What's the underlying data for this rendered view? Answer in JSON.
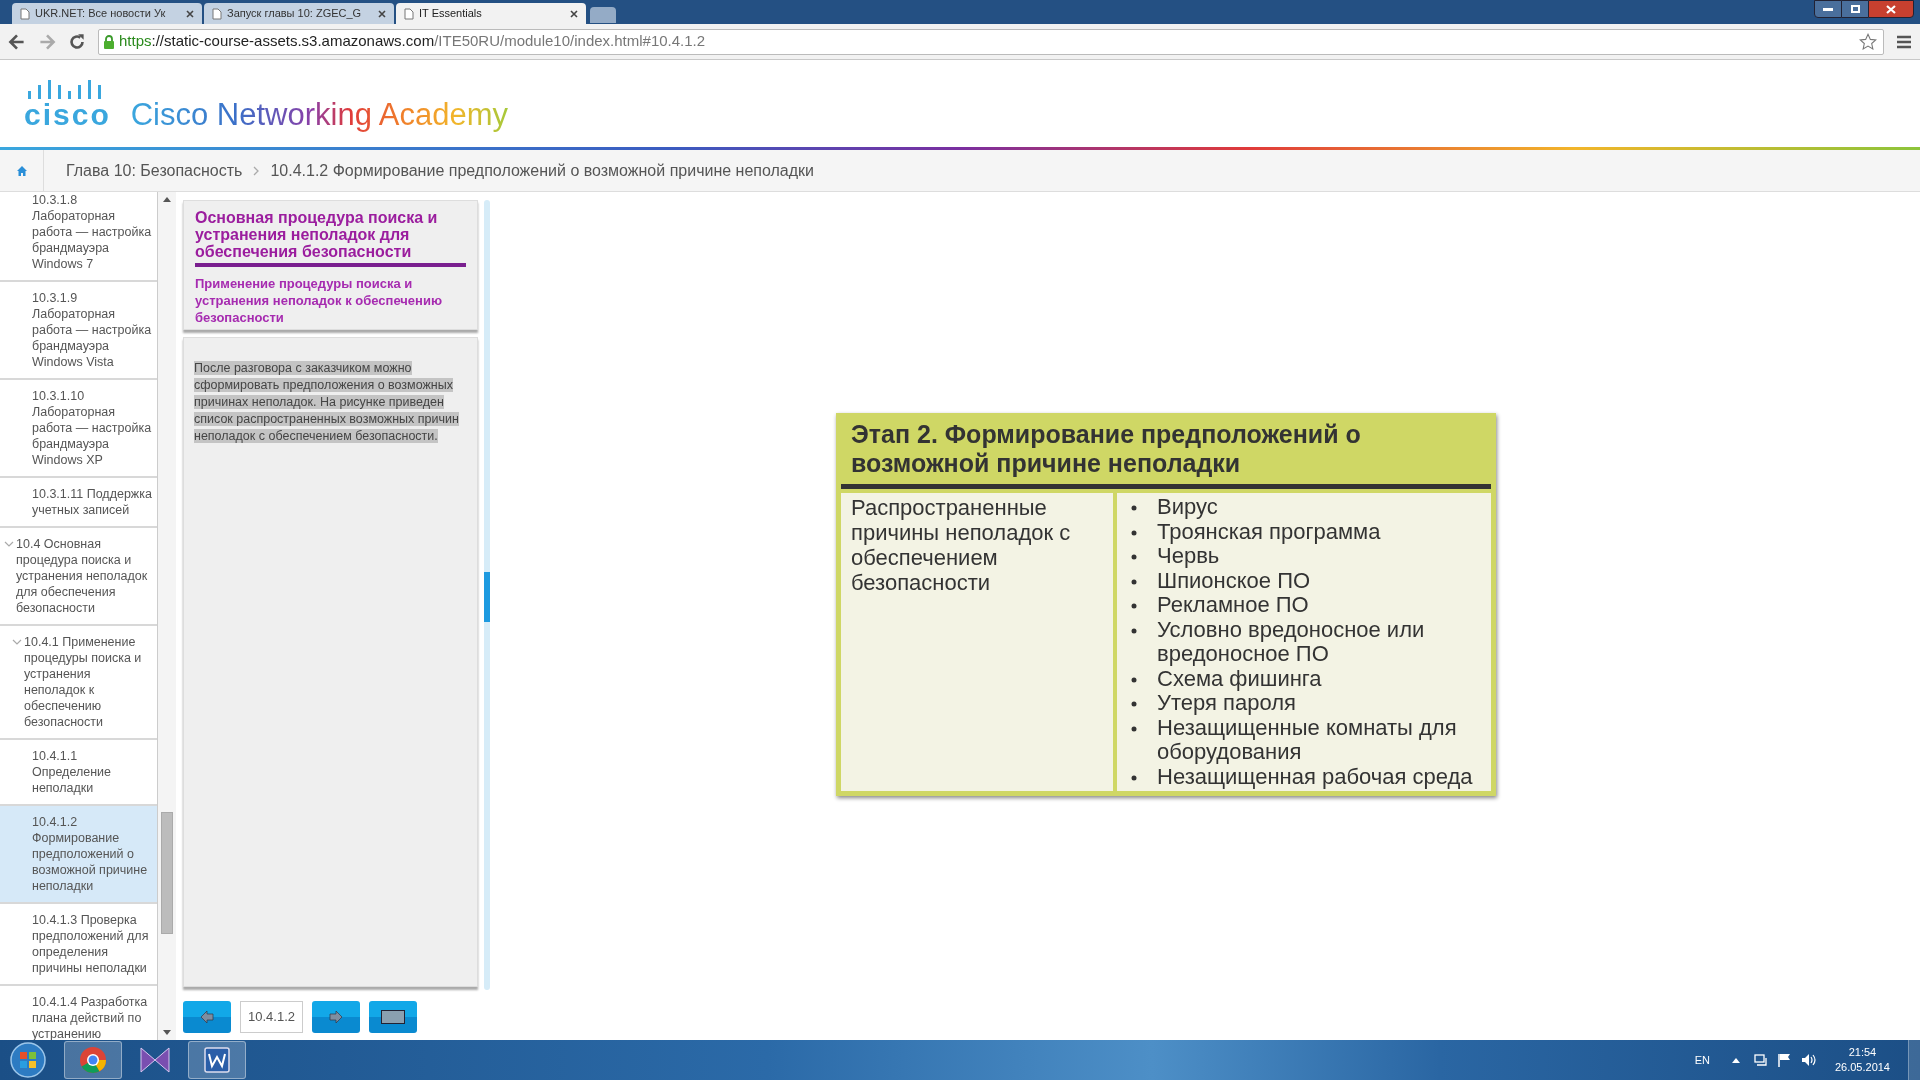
{
  "browser": {
    "tabs": [
      {
        "title": "UKR.NET: Все новости Ук",
        "selected": false
      },
      {
        "title": "Запуск главы 10: ZGEC_G",
        "selected": false
      },
      {
        "title": "IT Essentials",
        "selected": true
      }
    ],
    "url": {
      "scheme": "https",
      "host": "://static-course-assets.s3.amazonaws.com",
      "path": "/ITE50RU/module10/index.html#10.4.1.2"
    }
  },
  "header": {
    "logo_word": "cisco",
    "title": "Cisco Networking Academy"
  },
  "breadcrumb": [
    "Глава 10: Безопасность",
    "10.4.1.2 Формирование предположений о возможной причине неполадки"
  ],
  "sidebar": {
    "items": [
      {
        "label": "10.3.1.8 Лабораторная работа — настройка брандмауэра Windows 7",
        "selected": false
      },
      {
        "label": "10.3.1.9 Лабораторная работа — настройка брандмауэра Windows Vista",
        "selected": false
      },
      {
        "label": "10.3.1.10 Лабораторная работа — настройка брандмауэра Windows XP",
        "selected": false
      },
      {
        "label": "10.3.1.11 Поддержка учетных записей",
        "selected": false
      },
      {
        "label": "10.4 Основная процедура поиска и устранения неполадок для обеспечения безопасности",
        "selected": false,
        "expanded": true,
        "children": [
          {
            "label": "10.4.1 Применение процедуры поиска и устранения неполадок к обеспечению безопасности",
            "selected": false,
            "expanded": true,
            "children": [
              {
                "label": "10.4.1.1 Определение неполадки",
                "selected": false
              },
              {
                "label": "10.4.1.2 Формирование предположений о возможной причине неполадки",
                "selected": true
              },
              {
                "label": "10.4.1.3 Проверка предположений для определения причины неполадки",
                "selected": false
              },
              {
                "label": "10.4.1.4 Разработка плана действий по устранению",
                "selected": false
              }
            ]
          }
        ]
      }
    ]
  },
  "panel": {
    "title": "Основная процедура поиска и устранения неполадок для обеспечения безопасности",
    "subtitle": "Применение процедуры поиска и устранения неполадок к обеспечению безопасности",
    "text": "После разговора с заказчиком можно сформировать предположения о возможных причинах неполадок. На рисунке приведен список распространенных возможных причин неполадок с обеспечением безопасности.",
    "highlighted": true,
    "page": "10.4.1.2"
  },
  "figure": {
    "title": "Этап 2. Формирование предположений о возможной причине неполадки",
    "left": "Распространенные причины неполадок с обеспечением безопасности",
    "items": [
      "Вирус",
      "Троянская программа",
      "Червь",
      "Шпионское ПО",
      "Рекламное ПО",
      "Условно вредоносное или вредоносное ПО",
      "Схема фишинга",
      "Утеря пароля",
      "Незащищенные комнаты для оборудования",
      "Незащищенная рабочая среда"
    ]
  },
  "taskbar": {
    "language": "EN",
    "time": "21:54",
    "date": "26.05.2014"
  }
}
